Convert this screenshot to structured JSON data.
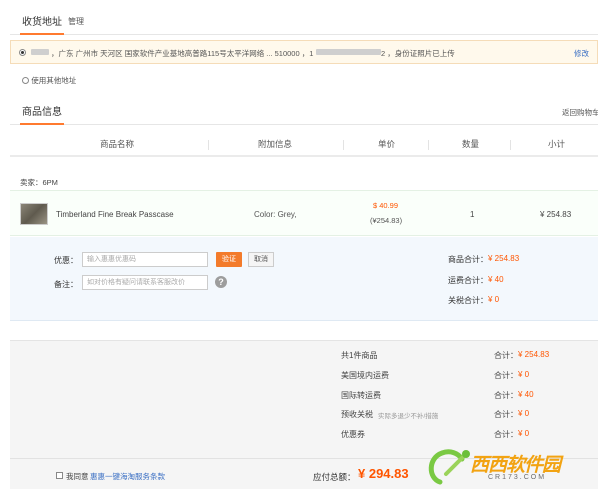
{
  "address": {
    "title": "收货地址",
    "manage": "管理",
    "selected_text": "，广东 广州市 天河区 国家软件产业基地高普路115号太平洋网络 ... 510000 ，1",
    "id_suffix": "2 ，身份证照片已上传",
    "edit": "修改",
    "other": "使用其他地址"
  },
  "goods": {
    "title": "商品信息",
    "back_cart": "返回购物车",
    "columns": [
      "商品名称",
      "附加信息",
      "单价",
      "数量",
      "小计"
    ],
    "seller": "卖家：6PM",
    "item": {
      "name": "Timberland Fine Break Passcase",
      "attr": "Color: Grey,",
      "price_usd": "$ 40.99",
      "price_cny": "(¥254.83)",
      "qty": "1",
      "subtotal": "¥ 254.83"
    }
  },
  "discount": {
    "coupon_label": "优惠：",
    "coupon_placeholder": "输入惠惠优惠码",
    "verify": "验证",
    "cancel": "取消",
    "note_label": "备注：",
    "note_placeholder": "如对价格有疑问请联系客服改价",
    "help": "?",
    "goods_total_label": "商品合计：",
    "goods_total": "¥ 254.83",
    "freight_total_label": "运费合计：",
    "freight_total": "¥ 40",
    "tax_total_label": "关税合计：",
    "tax_total": "¥ 0"
  },
  "summary": {
    "count_text": "共1件商品",
    "rows": [
      {
        "label": "美国境内运费",
        "total_label": "合计：",
        "value": "¥ 0"
      },
      {
        "label": "国际转运费",
        "total_label": "合计：",
        "value": "¥ 40"
      },
      {
        "label": "预收关税",
        "note": "实际多退少不补/措施",
        "total_label": "合计：",
        "value": "¥ 0"
      },
      {
        "label": "优惠券",
        "total_label": "合计：",
        "value": "¥ 0"
      }
    ],
    "goods_total_label": "合计：",
    "goods_total": "¥ 254.83"
  },
  "footer": {
    "agree_prefix": "我同意",
    "agree_link": "惠惠一键海淘服务条款",
    "payable_label": "应付总额：",
    "payable": "¥ 294.83"
  },
  "watermark": {
    "brand": "西西软件园",
    "site": "CR173.COM"
  }
}
